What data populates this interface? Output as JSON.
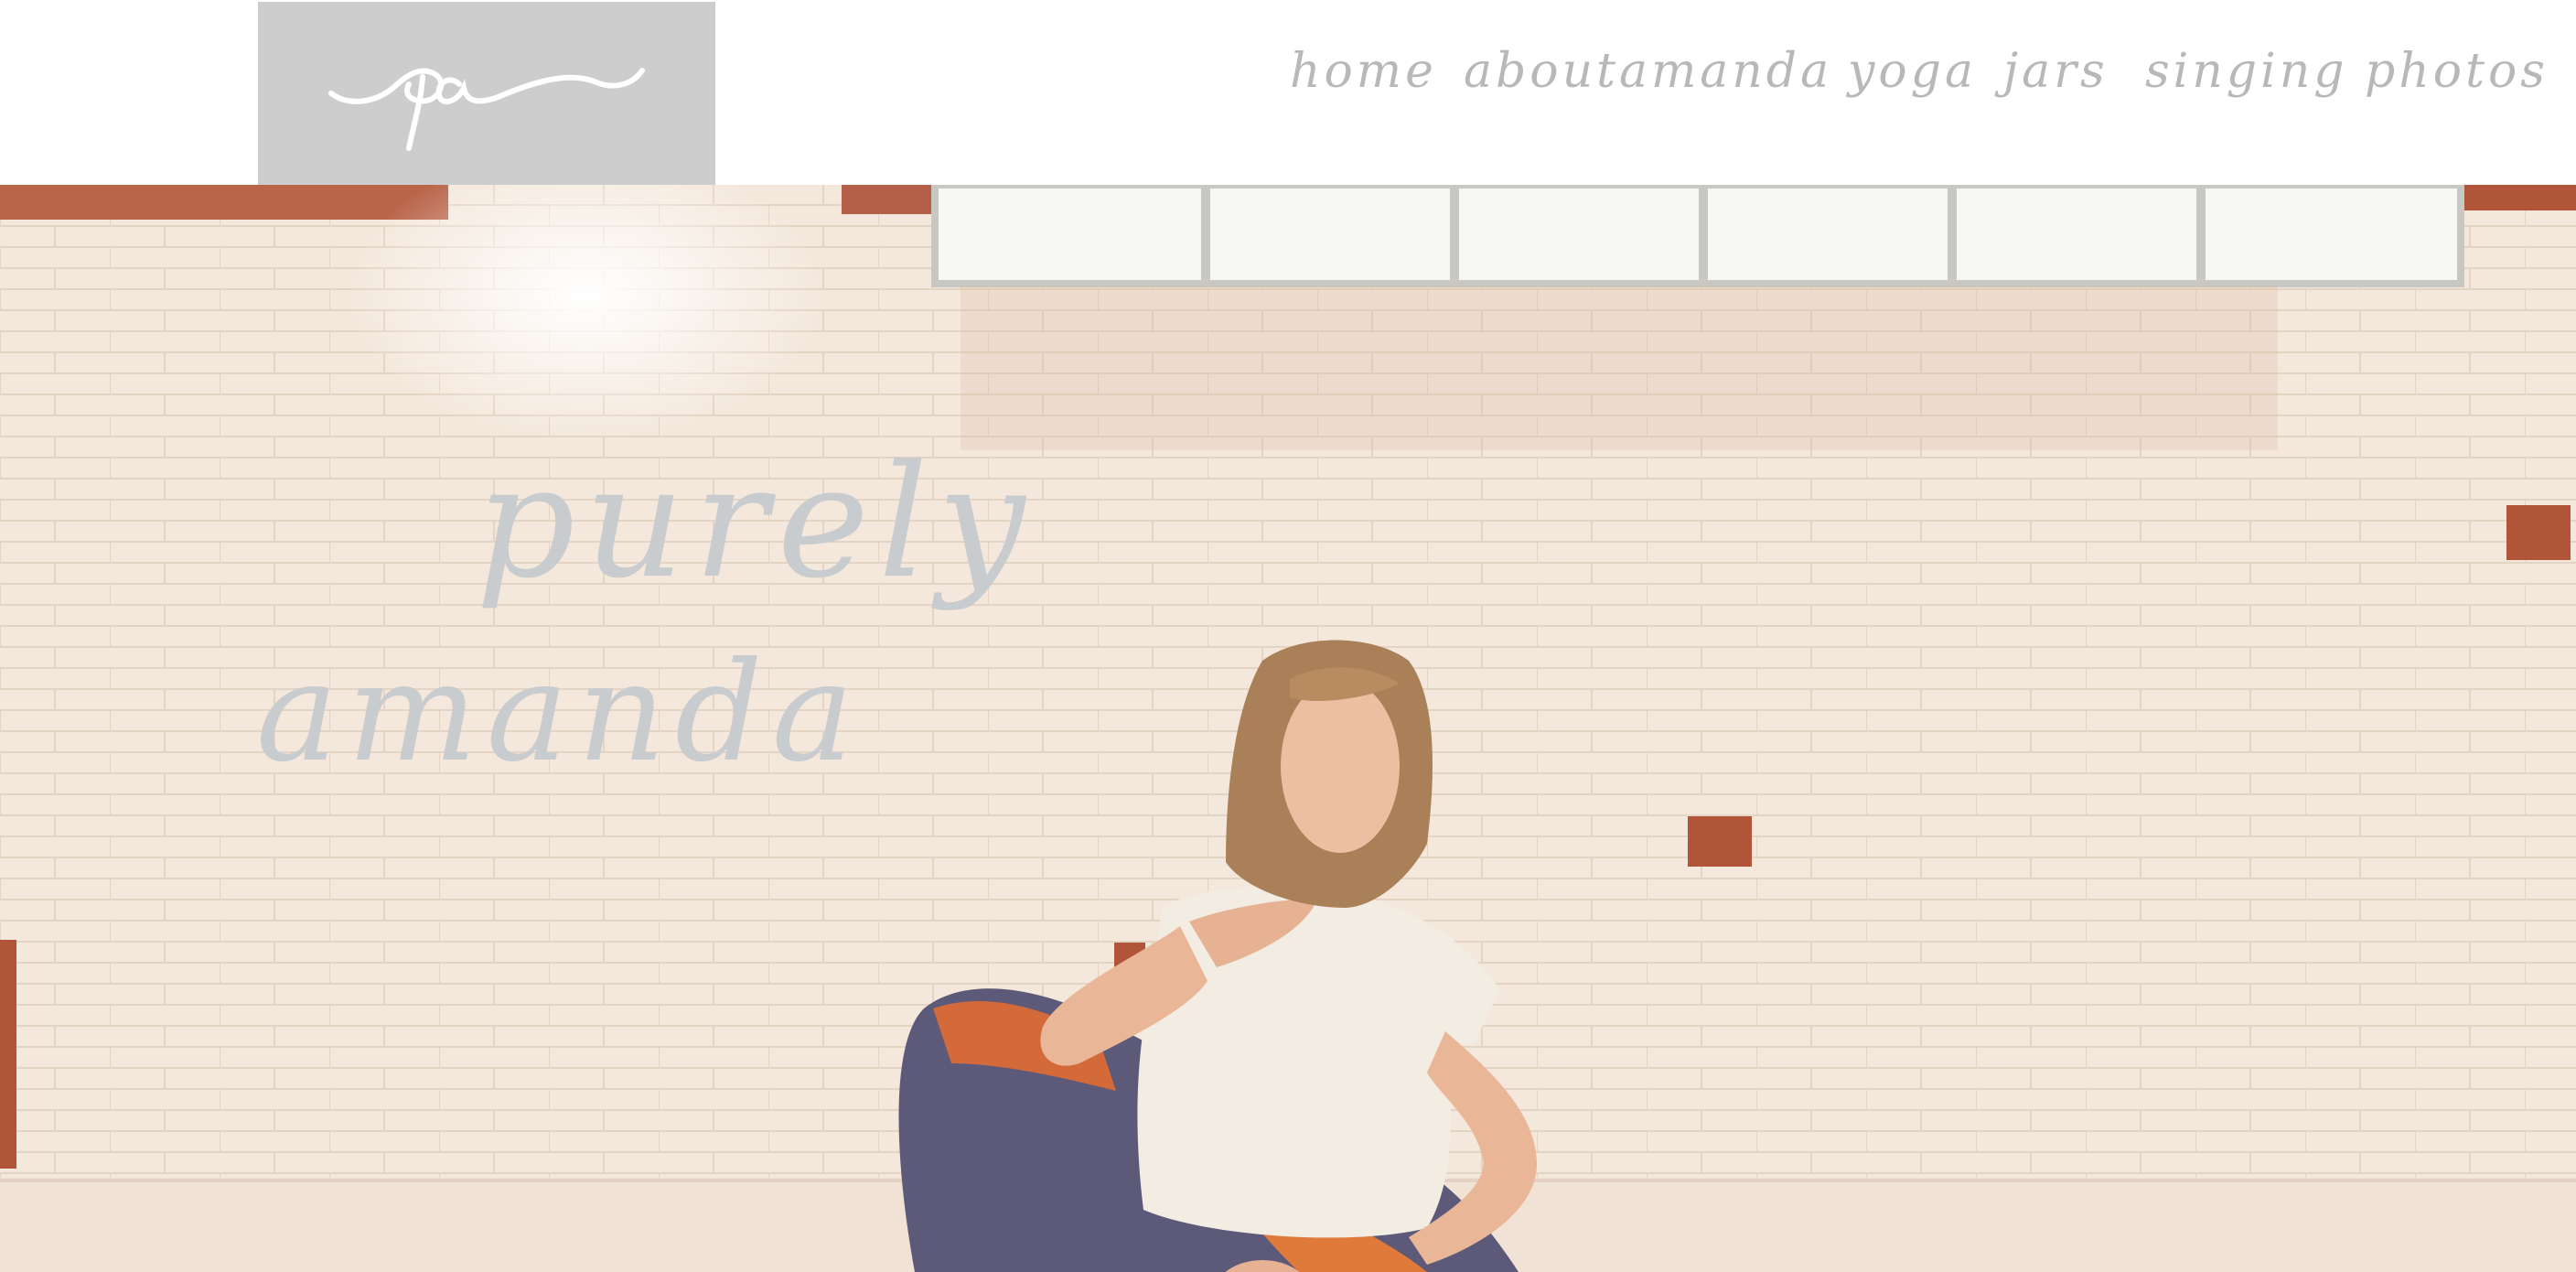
{
  "header": {
    "logo_text": "pa",
    "nav": [
      {
        "label": "home"
      },
      {
        "label": "aboutamanda"
      },
      {
        "label": "yoga"
      },
      {
        "label": "jars"
      },
      {
        "label": "singing"
      },
      {
        "label": "photos"
      }
    ]
  },
  "hero": {
    "title_line1": "purely",
    "title_line2": "amanda",
    "photo_subject": "woman-in-yoga-pose",
    "colors": {
      "wall": "#f3e6d9",
      "brick": "#b0553a",
      "title": "#c9ccce",
      "shirt": "#f2ece3"
    }
  }
}
